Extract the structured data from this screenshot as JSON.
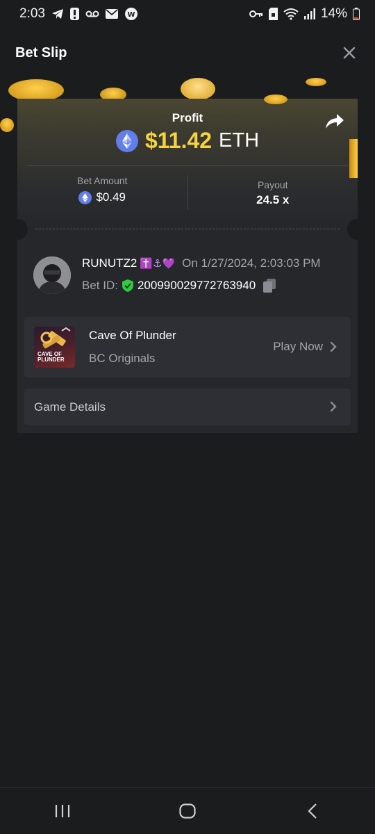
{
  "status_bar": {
    "time": "2:03",
    "battery": "14%"
  },
  "header": {
    "title": "Bet Slip"
  },
  "card": {
    "profit_label": "Profit",
    "profit_value": "$11.42",
    "profit_currency": "ETH",
    "bet_amount_label": "Bet Amount",
    "bet_amount_value": "$0.49",
    "payout_label": "Payout",
    "payout_value": "24.5 x"
  },
  "user": {
    "username": "RUNUTZ2",
    "username_emojis": "✝️⚓💜",
    "date": "On 1/27/2024, 2:03:03 PM",
    "bet_id_label": "Bet ID:",
    "bet_id_value": "200990029772763940"
  },
  "game": {
    "name": "Cave Of Plunder",
    "provider": "BC Originals",
    "play_label": "Play Now",
    "thumb_text_line1": "CAVE OF",
    "thumb_text_line2": "PLUNDER"
  },
  "details": {
    "label": "Game Details"
  },
  "colors": {
    "accent_gold": "#f5d33f",
    "eth_blue": "#627eea",
    "verified_green": "#2ecc40",
    "background": "#1b1c1e",
    "card": "#25272b"
  },
  "icons": {
    "close": "close-icon",
    "share": "share-icon",
    "eth": "eth-icon",
    "copy": "copy-icon",
    "chevron": "chevron-right-icon",
    "verified": "verified-shield-icon"
  }
}
